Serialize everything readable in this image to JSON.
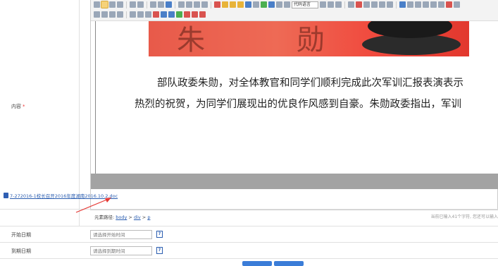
{
  "form": {
    "content_label": "内容",
    "required_mark": "*",
    "start_date_label": "开始日期",
    "start_date_placeholder": "请选择开始时间",
    "end_date_label": "到期日期",
    "end_date_placeholder": "请选择到期时间",
    "calendar_glyph": "?"
  },
  "editor": {
    "code_language_select": "代码语言",
    "paragraph_line1": "部队政委朱勋，对全体教官和同学们顺利完成此次军训汇报表演表示",
    "paragraph_line2": "热烈的祝贺，为同学们展现出的优良作风感到自豪。朱勋政委指出，军训",
    "photo_text_left": "朱",
    "photo_text_right": "勋",
    "attachment_link": "7-272016-1校长召开2016年度湖南2016.10.2.doc",
    "element_path_label": "元素路径: ",
    "element_path": [
      "body",
      "div",
      "p"
    ],
    "path_separator": " > ",
    "char_counter": "当前已输入41个字符, 您还可以输入"
  },
  "colors": {
    "link": "#2a5db0",
    "annotation_arrow": "#e53935",
    "primary_button": "#3b7dd8"
  }
}
